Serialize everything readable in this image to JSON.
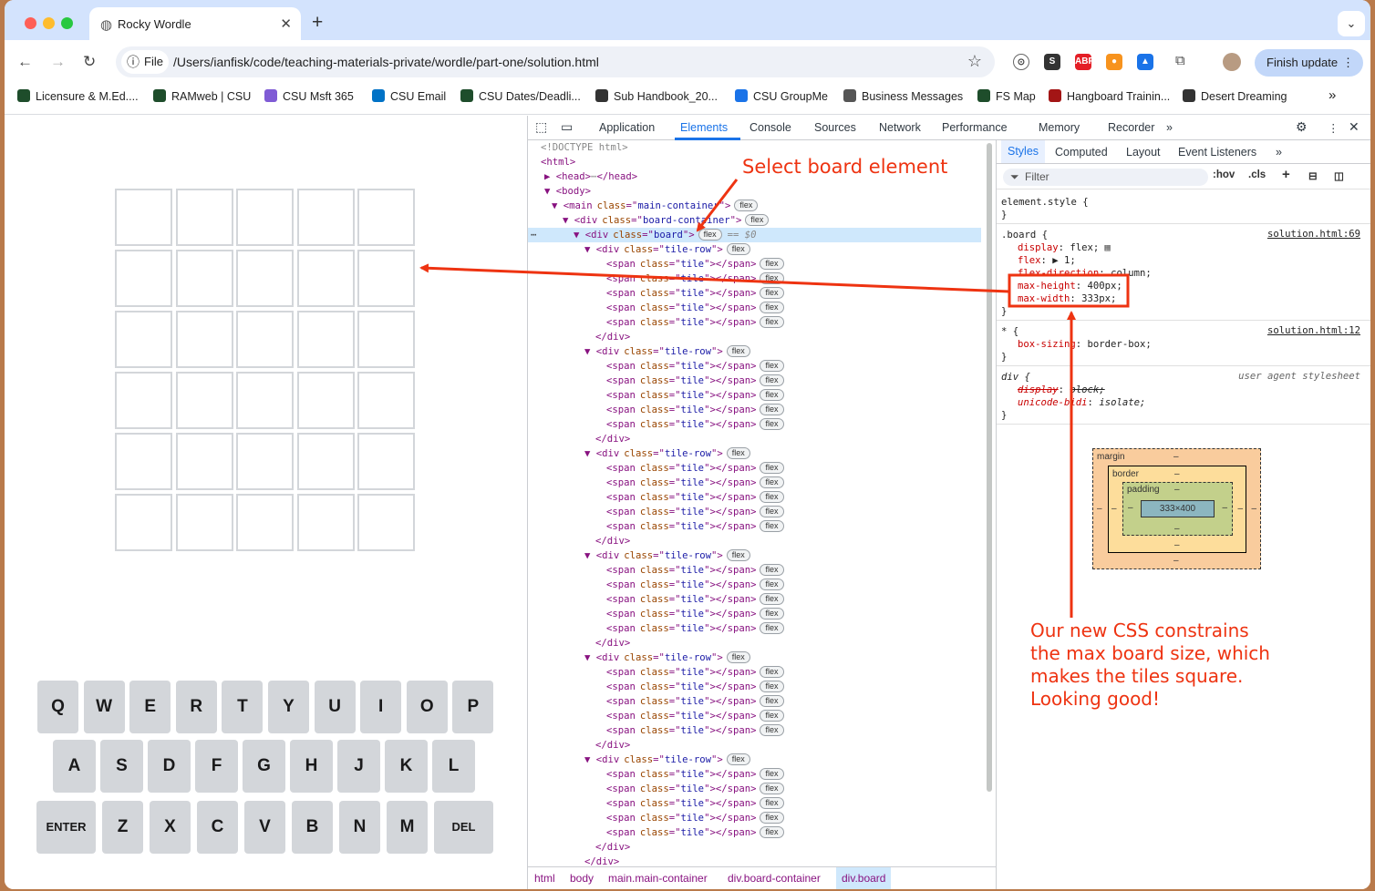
{
  "browser": {
    "tab_title": "Rocky Wordle",
    "new_tab_symbol": "+",
    "url_chip_label": "File",
    "url": "/Users/ianfisk/code/teaching-materials-private/wordle/part-one/solution.html",
    "finish_update_label": "Finish update",
    "bookmarks": [
      "Licensure & M.Ed....",
      "RAMweb | CSU",
      "CSU Msft 365",
      "CSU Email",
      "CSU Dates/Deadli...",
      "Sub Handbook_20...",
      "CSU GroupMe",
      "Business Messages",
      "FS Map",
      "Hangboard Trainin...",
      "Desert Dreaming"
    ],
    "extensions": [
      {
        "icon": "ext-circle-icon",
        "label": "⊙",
        "color": "#ffffff"
      },
      {
        "icon": "ext-s-icon",
        "label": "S",
        "color": "#333333"
      },
      {
        "icon": "adblock-icon",
        "label": "ABP",
        "color": "#e41e26"
      },
      {
        "icon": "ext-orange-icon",
        "label": "●",
        "color": "#f7931e"
      },
      {
        "icon": "ext-grad-icon",
        "label": "▲",
        "color": "#1a73e8"
      }
    ]
  },
  "keyboard": {
    "row1": [
      "Q",
      "W",
      "E",
      "R",
      "T",
      "Y",
      "U",
      "I",
      "O",
      "P"
    ],
    "row2": [
      "A",
      "S",
      "D",
      "F",
      "G",
      "H",
      "J",
      "K",
      "L"
    ],
    "row3": [
      "ENTER",
      "Z",
      "X",
      "C",
      "V",
      "B",
      "N",
      "M",
      "DEL"
    ]
  },
  "devtools": {
    "tabs": [
      "Application",
      "Elements",
      "Console",
      "Sources",
      "Network",
      "Performance",
      "Memory",
      "Recorder"
    ],
    "active_tab": "Elements",
    "doctype": "<!DOCTYPE html>",
    "html_open": "<html>",
    "head_line": "<head>",
    "head_close": "</head>",
    "ellipsis_badge": "⋯",
    "body_open": "<body>",
    "main_tag": "<main",
    "main_class": "main-container",
    "board_container_class": "board-container",
    "board_class": "board",
    "selected_marker": "== $0",
    "row_class": "tile-row",
    "tile_class": "tile",
    "div_close": "</div>",
    "flex_badge": "flex",
    "attr_class": "class",
    "div_tag": "<div",
    "span_tag": "<span",
    "span_close": "></span>",
    "breadcrumbs": [
      "html",
      "body",
      "main.main-container",
      "div.board-container",
      "div.board"
    ]
  },
  "styles": {
    "tabs": [
      "Styles",
      "Computed",
      "Layout",
      "Event Listeners"
    ],
    "filter_placeholder": "Filter",
    "hov": ":hov",
    "cls": ".cls",
    "element_style": "element.style {",
    "close_brace": "}",
    "rule1_selector": ".board {",
    "rule1_source": "solution.html:69",
    "rule1_props": [
      [
        "display",
        "flex;"
      ],
      [
        "flex",
        "▶ 1;"
      ],
      [
        "flex-direction",
        "column;"
      ],
      [
        "max-height",
        "400px;"
      ],
      [
        "max-width",
        "333px;"
      ]
    ],
    "rule2_selector": "* {",
    "rule2_source": "solution.html:12",
    "rule2_props": [
      [
        "box-sizing",
        "border-box;"
      ]
    ],
    "rule3_selector": "div {",
    "rule3_source": "user agent stylesheet",
    "rule3_props": [
      [
        "display",
        "block;"
      ],
      [
        "unicode-bidi",
        "isolate;"
      ]
    ],
    "box_margin": "margin",
    "box_border": "border",
    "box_padding": "padding",
    "box_content": "333×400",
    "box_dash": "–"
  },
  "annotations": {
    "select_board": "Select board element",
    "explanation": [
      "Our new CSS constrains",
      "the max board size, which",
      "makes the tiles square.",
      "Looking good!"
    ],
    "color": "#ee3311"
  }
}
